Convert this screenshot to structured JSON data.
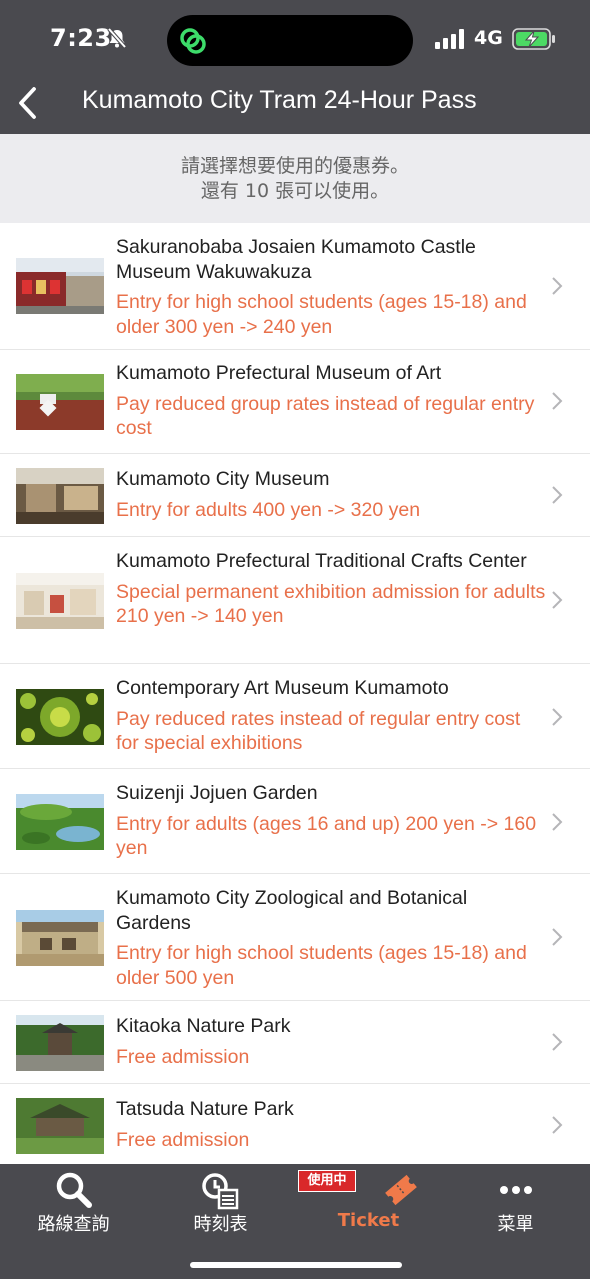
{
  "status_bar": {
    "time": "7:23",
    "network": "4G"
  },
  "header": {
    "title": "Kumamoto City Tram 24-Hour Pass"
  },
  "notice": {
    "line1": "請選擇想要使用的優惠券。",
    "line2": "還有 10 張可以使用。"
  },
  "items": [
    {
      "name": "Sakuranobaba Josaien Kumamoto Castle Museum Wakuwakuza",
      "desc": "Entry for high school students (ages 15-18) and older 300 yen -> 240 yen"
    },
    {
      "name": "Kumamoto Prefectural Museum of Art",
      "desc": "Pay reduced group rates instead of regular entry cost"
    },
    {
      "name": "Kumamoto City Museum",
      "desc": "Entry for adults 400 yen -> 320 yen"
    },
    {
      "name": "Kumamoto Prefectural Traditional Crafts Center",
      "desc": "Special permanent exhibition admission for adults 210 yen -> 140 yen"
    },
    {
      "name": "Contemporary Art Museum Kumamoto",
      "desc": "Pay reduced rates instead of regular entry cost for special exhibitions"
    },
    {
      "name": "Suizenji Jojuen Garden",
      "desc": "Entry for adults (ages 16 and up) 200 yen -> 160 yen"
    },
    {
      "name": "Kumamoto City Zoological and Botanical Gardens",
      "desc": "Entry for high school students (ages 15-18) and older 500 yen"
    },
    {
      "name": "Kitaoka Nature Park",
      "desc": "Free admission"
    },
    {
      "name": "Tatsuda Nature Park",
      "desc": "Free admission"
    }
  ],
  "tabbar": {
    "tabs": [
      {
        "label": "路線查詢",
        "icon": "search-icon"
      },
      {
        "label": "時刻表",
        "icon": "timetable-icon"
      },
      {
        "label": "Ticket",
        "icon": "ticket-icon"
      },
      {
        "label": "菜單",
        "icon": "more-icon"
      }
    ],
    "active_badge": "使用中"
  },
  "colors": {
    "accent": "#e8704a",
    "header_bg": "#4a4a4f",
    "notice_bg": "#ececef"
  }
}
